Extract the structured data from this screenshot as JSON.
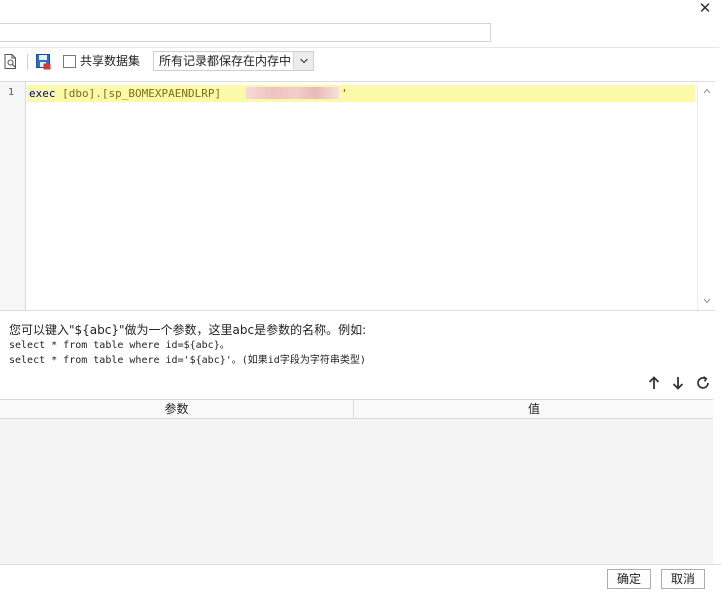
{
  "window": {
    "close_glyph": "✕"
  },
  "dataset_name": {
    "value": ""
  },
  "toolbar": {
    "preview_icon": "preview-icon",
    "save_icon": "save-icon",
    "share_dataset_label": "共享数据集",
    "share_dataset_checked": false,
    "record_mode": {
      "selected": "所有记录都保存在内存中"
    }
  },
  "editor": {
    "line_number": "1",
    "code_keyword": "exec",
    "code_rest": " [dbo].[sp_BOMEXPAENDLRP] ",
    "code_end_quote": "'",
    "highlight_color": "#fafaa8"
  },
  "hint": {
    "line1": "您可以键入\"${abc}\"做为一个参数，这里abc是参数的名称。例如:",
    "line2": "select * from table where id=${abc}。",
    "line3": "select * from table where id='${abc}'。(如果id字段为字符串类型)"
  },
  "param_table": {
    "columns": [
      "参数",
      "值"
    ],
    "rows": []
  },
  "buttons": {
    "ok": "确定",
    "cancel": "取消"
  }
}
